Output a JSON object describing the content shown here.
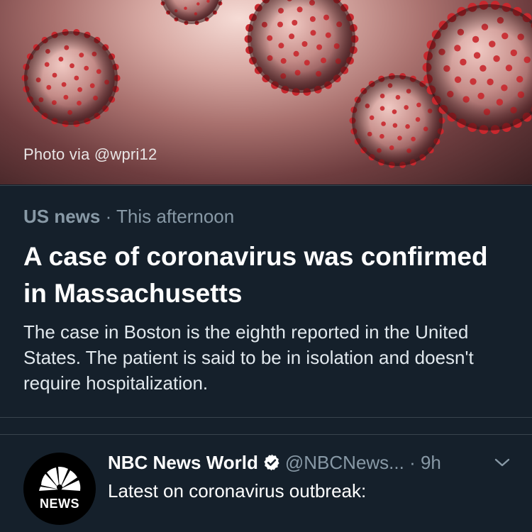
{
  "card": {
    "photo_credit": "Photo via @wpri12",
    "category": "US news",
    "separator": " · ",
    "time": "This afternoon",
    "headline": "A case of coronavirus was confirmed in Massachusetts",
    "summary": "The case in Boston is the eighth reported in the United States. The patient is said to be in isolation and doesn't require hospitalization."
  },
  "tweet": {
    "display_name": "NBC News World",
    "handle": "@NBCNews...",
    "separator": " · ",
    "timestamp": "9h",
    "text": "Latest on coronavirus outbreak:",
    "avatar_label": "NEWS",
    "verified_icon": "verified-badge-icon",
    "menu_icon": "chevron-down-icon"
  },
  "colors": {
    "background": "#15202b",
    "secondary_text": "#8899a6",
    "divider": "#38444d",
    "virus_red": "#c8282e"
  }
}
